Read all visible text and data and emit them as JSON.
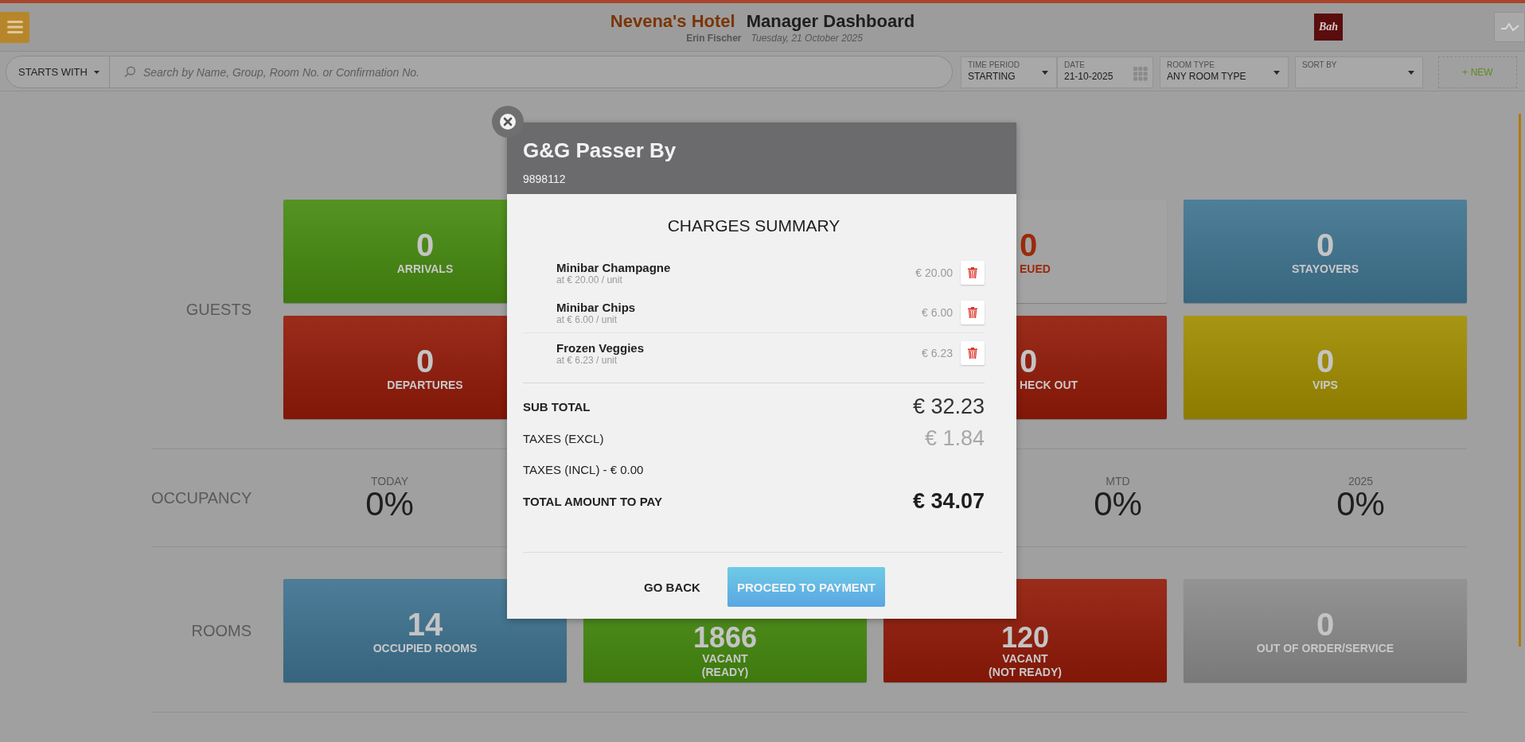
{
  "header": {
    "hotel_name": "Nevena's Hotel",
    "title": "Manager Dashboard",
    "user": "Erin Fischer",
    "date": "Tuesday, 21 October 2025",
    "logo_text": "Bah"
  },
  "search": {
    "mode": "STARTS WITH",
    "placeholder": "Search by Name, Group, Room No. or Confirmation No."
  },
  "filters": [
    {
      "label": "TIME PERIOD",
      "value": "STARTING",
      "kind": "dropdown"
    },
    {
      "label": "DATE",
      "value": "21-10-2025",
      "kind": "date"
    },
    {
      "label": "ROOM TYPE",
      "value": "ANY ROOM TYPE",
      "kind": "dropdown"
    },
    {
      "label": "SORT BY",
      "kind": "dropdown"
    }
  ],
  "new_button": "+ NEW",
  "sections": [
    {
      "title": "GUESTS",
      "kind": "tiles",
      "tiles": [
        {
          "number": "0",
          "label": "ARRIVALS",
          "kind": "solid",
          "color": "#468a10"
        },
        {
          "number": "0",
          "label": "EUED",
          "kind": "plain",
          "color": "#9a2a0a",
          "cut_left": true
        },
        {
          "number": "0",
          "label": "STAYOVERS",
          "kind": "solid",
          "color": "#3f7490"
        },
        {
          "number": "0",
          "label": "DEPARTURES",
          "kind": "solid",
          "color": "#921a08"
        },
        {
          "number": "0",
          "label": "HECK OUT",
          "kind": "solid",
          "color": "#921a08",
          "cut_left": true
        },
        {
          "number": "0",
          "label": "VIPS",
          "kind": "solid",
          "color": "#a08c00"
        }
      ]
    },
    {
      "title": "OCCUPANCY",
      "kind": "stats",
      "stats": [
        {
          "label": "TODAY",
          "value": "0%"
        },
        {
          "label": "MTD",
          "value": "0%"
        },
        {
          "label": "2025",
          "value": "0%"
        }
      ]
    },
    {
      "title": "ROOMS",
      "kind": "tiles",
      "tiles": [
        {
          "number": "14",
          "label": "OCCUPIED ROOMS",
          "kind": "solid",
          "color": "#3e7290"
        },
        {
          "number": "1866",
          "label": "VACANT\n(READY)",
          "kind": "solid",
          "color": "#468a10",
          "cut_top": true
        },
        {
          "number": "120",
          "label": "VACANT\n(NOT READY)",
          "kind": "solid",
          "color": "#921a08",
          "cut_top": true
        },
        {
          "number": "0",
          "label": "OUT OF ORDER/SERVICE",
          "kind": "solid",
          "color": "#8a8a8a"
        }
      ]
    }
  ],
  "modal": {
    "title": "G&G Passer By",
    "subtitle": "9898112",
    "heading": "CHARGES SUMMARY",
    "items": [
      {
        "name": "Minibar Champagne",
        "unit": "at € 20.00 / unit",
        "amount": "€ 20.00"
      },
      {
        "name": "Minibar Chips",
        "unit": "at € 6.00 / unit",
        "amount": "€ 6.00"
      },
      {
        "name": "Frozen Veggies",
        "unit": "at € 6.23 / unit",
        "amount": "€ 6.23"
      }
    ],
    "totals": [
      {
        "label": "SUB TOTAL",
        "value": "€ 32.23",
        "kind": "sub"
      },
      {
        "label": "TAXES (EXCL)",
        "value": "€ 1.84",
        "kind": "tax"
      },
      {
        "label": "TAXES (INCL) - € 0.00",
        "kind": "note"
      },
      {
        "label": "TOTAL AMOUNT TO PAY",
        "value": "€ 34.07",
        "kind": "total"
      }
    ],
    "back_button": "GO BACK",
    "pay_button": "PROCEED TO PAYMENT"
  }
}
